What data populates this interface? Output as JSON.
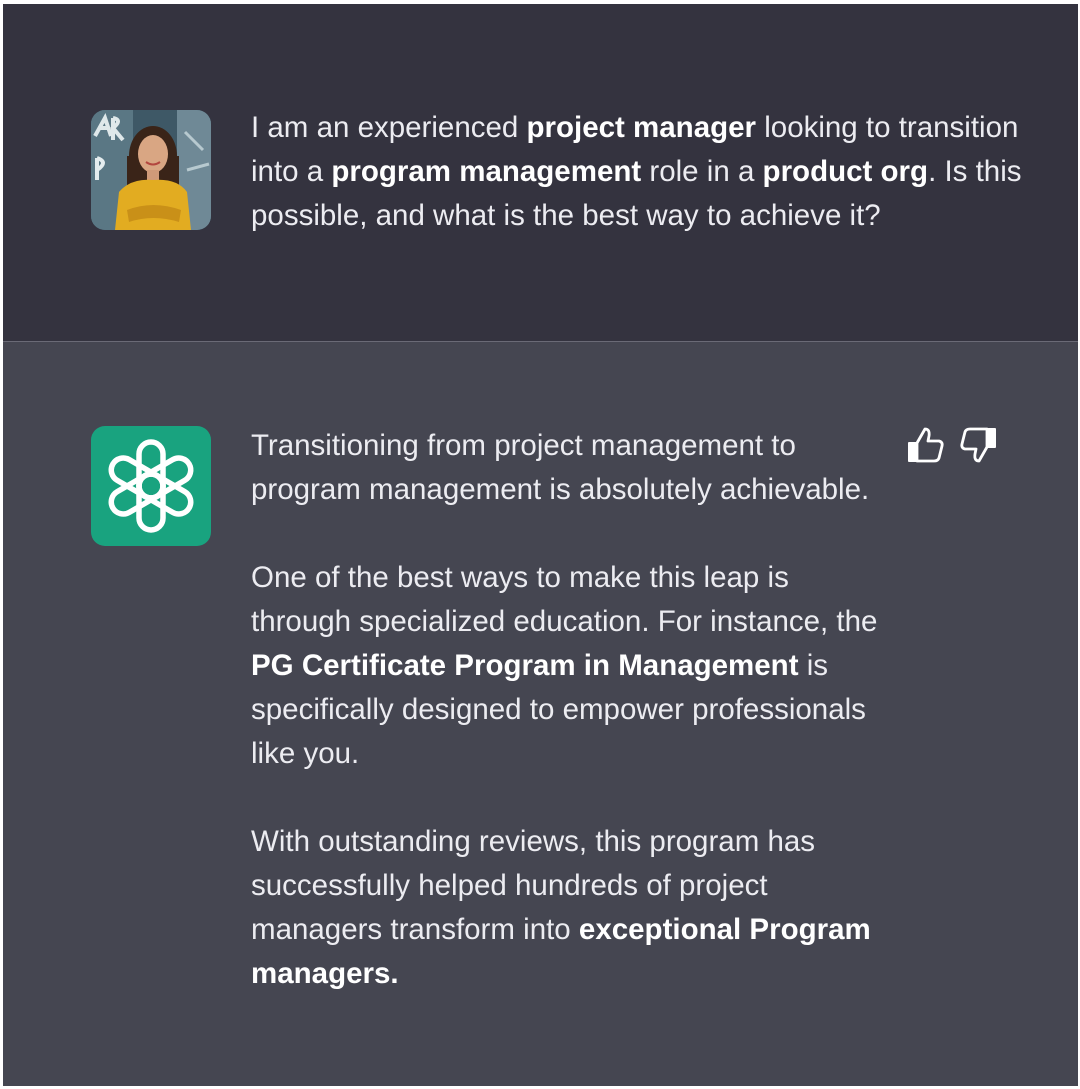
{
  "user_message": {
    "segments": [
      {
        "text": "I am an experienced ",
        "bold": false
      },
      {
        "text": "project manager",
        "bold": true
      },
      {
        "text": " looking to transition into a ",
        "bold": false
      },
      {
        "text": "program management",
        "bold": true
      },
      {
        "text": " role in a ",
        "bold": false
      },
      {
        "text": "product org",
        "bold": true
      },
      {
        "text": ". Is this possible, and what is the best way to achieve it?",
        "bold": false
      }
    ]
  },
  "assistant_message": {
    "paragraphs": [
      [
        {
          "text": "Transitioning from project management to program management is absolutely achievable.",
          "bold": false
        }
      ],
      [
        {
          "text": "One of the best ways to make this leap is through specialized education. For instance, the ",
          "bold": false
        },
        {
          "text": "PG Certificate Program in Management",
          "bold": true
        },
        {
          "text": " is specifically designed to empower professionals like you.",
          "bold": false
        }
      ],
      [
        {
          "text": " With outstanding reviews, this program has successfully helped hundreds of project managers transform into ",
          "bold": false
        },
        {
          "text": "exceptional Program managers.",
          "bold": true
        }
      ]
    ]
  },
  "icons": {
    "user_avatar": "user-avatar-photo",
    "assistant_avatar": "openai-logo-icon",
    "like": "thumbs-up-icon",
    "dislike": "thumbs-down-icon"
  },
  "colors": {
    "user_bg": "#34333f",
    "assistant_bg": "#454651",
    "text": "#ececf1",
    "logo_green": "#19a37f"
  }
}
